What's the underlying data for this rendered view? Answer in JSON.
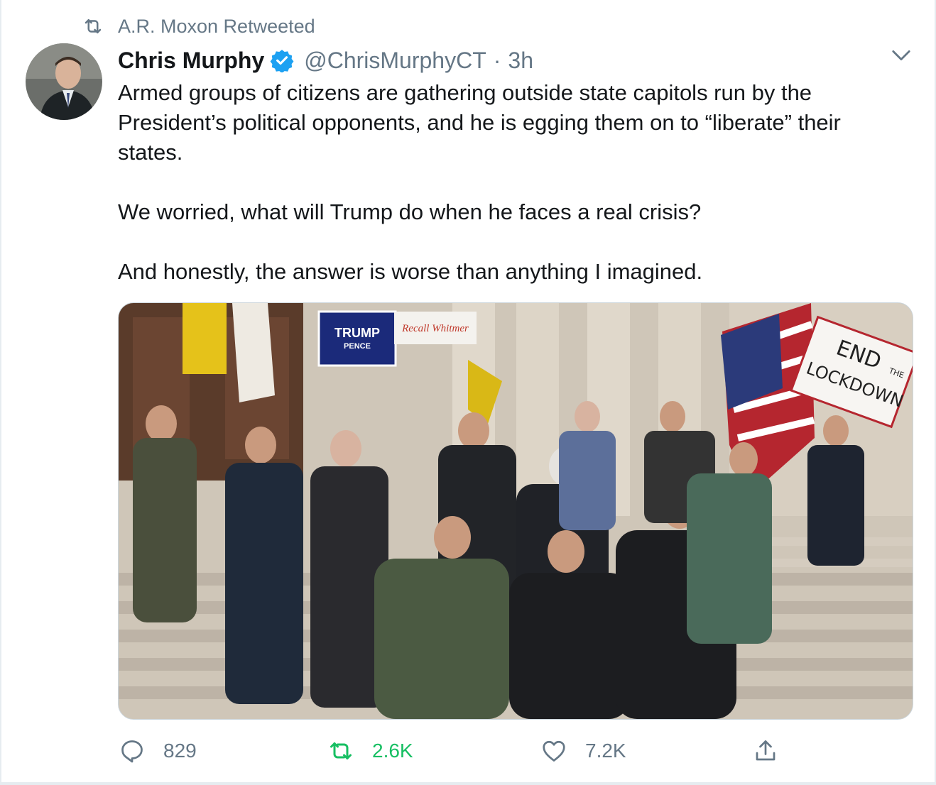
{
  "retweet_banner": {
    "icon": "retweet-icon",
    "text": "A.R. Moxon Retweeted"
  },
  "tweet": {
    "author": {
      "name": "Chris Murphy",
      "verified": true,
      "handle": "@ChrisMurphyCT",
      "separator": "·",
      "time": "3h",
      "avatar": "avatar-image"
    },
    "menu_icon": "chevron-down-icon",
    "text": {
      "paragraph_1_line_1": "Armed groups of citizens are gathering outside state capitols run by the",
      "paragraph_1_line_2": "President’s political opponents, and he is egging them on to “liberate” their",
      "paragraph_1_line_3": "states.",
      "paragraph_2": "We worried, what will Trump do when he faces a real crisis?",
      "paragraph_3": "And honestly, the answer is worse than anything I imagined."
    },
    "media": {
      "alt": "photo",
      "signs": {
        "trump_sign_line1": "TRUMP",
        "trump_sign_line2": "PENCE",
        "recall_sign": "Recall Whitmer",
        "end_sign_line1": "END",
        "end_sign_line2": "THE",
        "end_sign_line3": "LOCKDOWN"
      }
    },
    "actions": {
      "reply": {
        "icon": "reply-icon",
        "count": "829"
      },
      "retweet": {
        "icon": "retweet-icon",
        "count": "2.6K",
        "active_color": "#17bf63"
      },
      "like": {
        "icon": "heart-icon",
        "count": "7.2K"
      },
      "share": {
        "icon": "share-icon"
      }
    }
  },
  "colors": {
    "text": "#14171a",
    "secondary": "#657786",
    "verified": "#1da1f2",
    "retweet_green": "#17bf63",
    "border": "#ccd6dd"
  }
}
